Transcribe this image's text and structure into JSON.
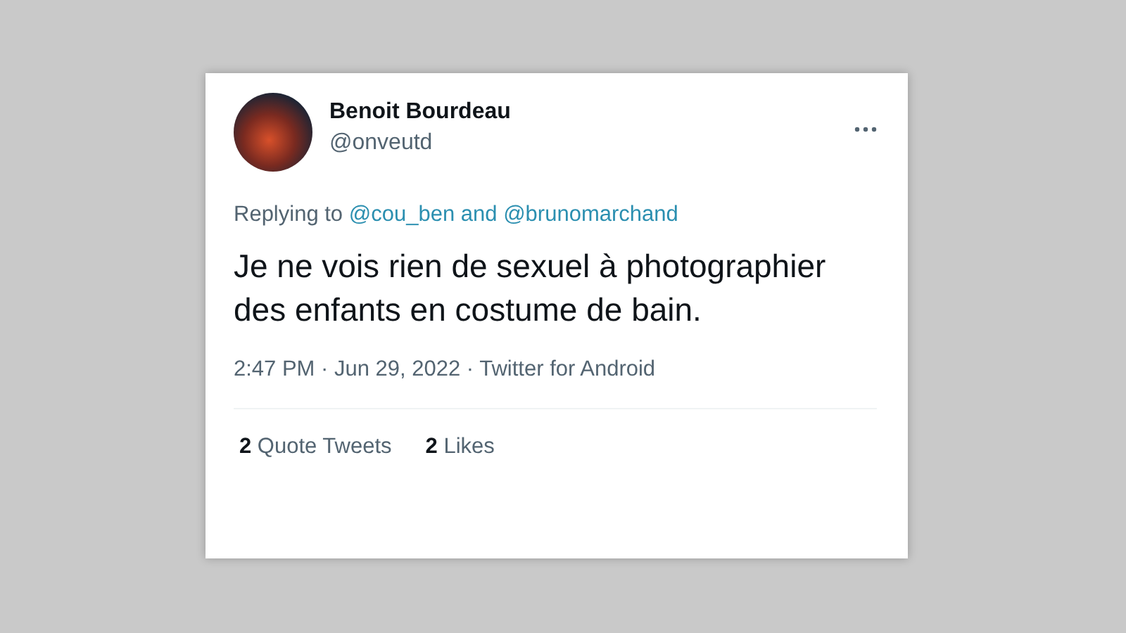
{
  "tweet": {
    "author": {
      "name": "Benoit Bourdeau",
      "handle": "@onveutd"
    },
    "reply": {
      "prefix": "Replying to",
      "mentions": [
        "@cou_ben",
        "@brunomarchand"
      ],
      "joiner": "and"
    },
    "text": "Je ne vois rien de sexuel à photographier des enfants en costume de bain.",
    "meta": "2:47 PM · Jun 29, 2022 · Twitter for Android",
    "stats": [
      {
        "text": "**2** Quote Tweets"
      },
      {
        "text": "**2** Likes"
      }
    ]
  }
}
